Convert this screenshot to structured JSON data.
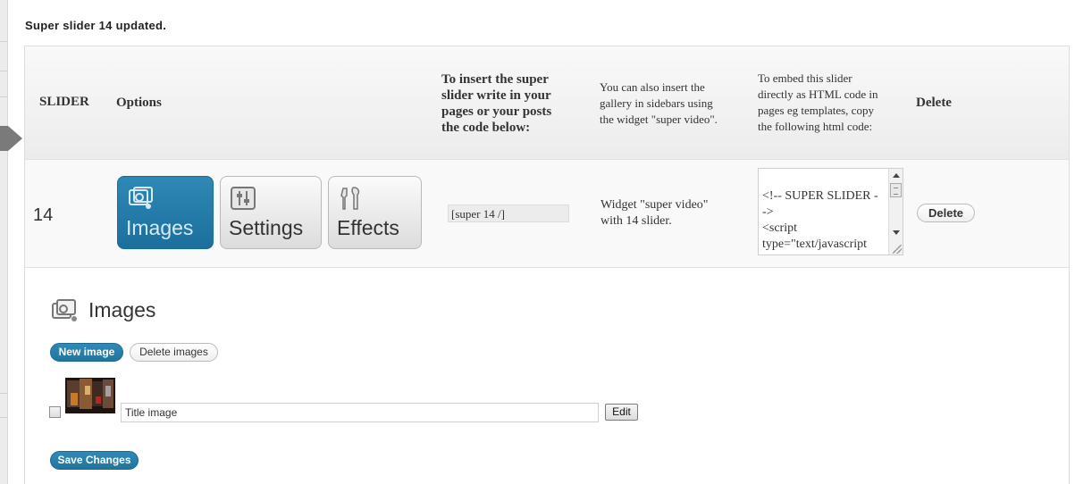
{
  "notice": "Super slider 14 updated.",
  "table": {
    "headers": {
      "slider": "SLIDER",
      "options": "Options",
      "insert": [
        "To insert the super",
        "slider write in your",
        "pages or your posts",
        "the code below:"
      ],
      "widget": [
        "You can also insert the",
        "gallery in sidebars using",
        "the widget \"super video\"."
      ],
      "embed": [
        "To embed this slider",
        "directly as HTML code in",
        "pages eg templates, copy",
        "the following html code:"
      ],
      "delete": "Delete"
    },
    "row": {
      "id": "14",
      "options": [
        {
          "label": "Images",
          "icon": "images-icon",
          "active": true
        },
        {
          "label": "Settings",
          "icon": "settings-icon",
          "active": false
        },
        {
          "label": "Effects",
          "icon": "effects-icon",
          "active": false
        }
      ],
      "shortcode": "[super 14 /]",
      "widget_text": [
        "Widget \"super video\"",
        "with 14 slider."
      ],
      "html_code": "<!-- SUPER SLIDER -\n->\n<script\ntype=\"text/javascript",
      "delete_label": "Delete"
    }
  },
  "images_section": {
    "title": "Images",
    "new_image_label": "New image",
    "delete_images_label": "Delete images",
    "items": [
      {
        "title_value": "Title image",
        "edit_label": "Edit",
        "checked": false
      }
    ],
    "save_label": "Save Changes"
  },
  "colors": {
    "accent": "#21759b",
    "active_tab": "#1c6f9c"
  }
}
